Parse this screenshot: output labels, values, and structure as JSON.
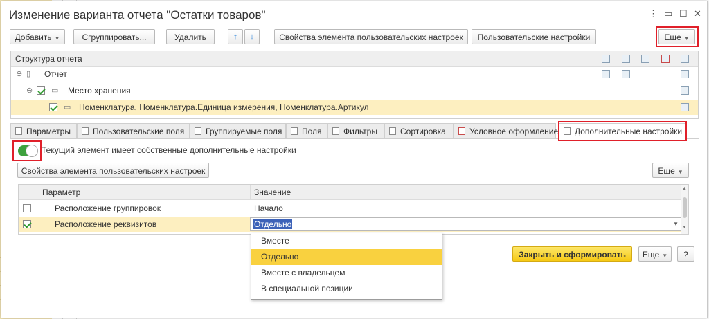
{
  "window": {
    "title": "Изменение варианта отчета \"Остатки товаров\""
  },
  "toolbar": {
    "add_label": "Добавить",
    "group_label": "Сгруппировать...",
    "delete_label": "Удалить",
    "properties_label": "Свойства элемента пользовательских настроек",
    "user_settings_label": "Пользовательские настройки",
    "more_label": "Еще"
  },
  "structure": {
    "header": "Структура отчета",
    "rows": [
      {
        "label": "Отчет"
      },
      {
        "label": "Место хранения"
      },
      {
        "label": "Номенклатура, Номенклатура.Единица измерения, Номенклатура.Артикул"
      }
    ]
  },
  "tabs": [
    {
      "label": "Параметры"
    },
    {
      "label": "Пользовательские поля"
    },
    {
      "label": "Группируемые поля"
    },
    {
      "label": "Поля"
    },
    {
      "label": "Фильтры"
    },
    {
      "label": "Сортировка"
    },
    {
      "label": "Условное оформление"
    },
    {
      "label": "Дополнительные настройки"
    }
  ],
  "extra": {
    "toggle_label": "Текущий элемент имеет собственные дополнительные настройки",
    "properties_label": "Свойства элемента пользовательских настроек",
    "more_label": "Еще"
  },
  "params_table": {
    "columns": [
      "Параметр",
      "Значение"
    ],
    "rows": [
      {
        "param": "Расположение группировок",
        "value": "Начало",
        "checked": false
      },
      {
        "param": "Расположение реквизитов",
        "value": "Отдельно",
        "checked": true
      }
    ]
  },
  "dropdown": {
    "options": [
      "Вместе",
      "Отдельно",
      "Вместе с владельцем",
      "В специальной позиции"
    ],
    "selected": "Отдельно"
  },
  "footer": {
    "close_label": "Закрыть и сформировать",
    "more_label": "Еще",
    "help_label": "?"
  },
  "colors": {
    "highlight": "#e0202a",
    "accent": "#f6c915",
    "selection": "#fdefc0"
  }
}
